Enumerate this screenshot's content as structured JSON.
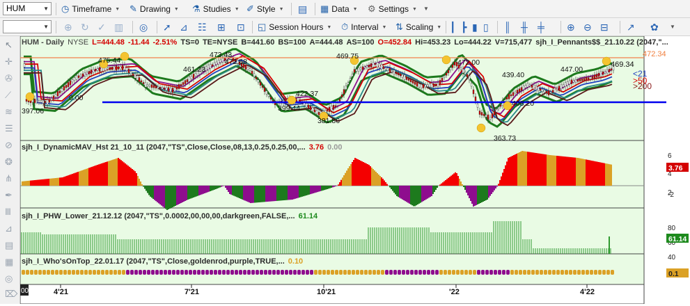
{
  "toolbar1": {
    "symbol": "HUM",
    "timeframe": "Timeframe",
    "drawing": "Drawing",
    "studies": "Studies",
    "style": "Style",
    "data": "Data",
    "settings": "Settings"
  },
  "toolbar2": {
    "session_hours": "Session Hours",
    "interval": "Interval",
    "scaling": "Scaling"
  },
  "price_header": {
    "title": "HUM - Daily",
    "exchange": "NYSE",
    "last": "L=444.48",
    "change": "-11.44",
    "change_pct": "-2.51%",
    "ts": "TS=0",
    "te": "TE=NYSE",
    "bid": "B=441.60",
    "bs": "BS=100",
    "ask": "A=444.48",
    "as": "AS=100",
    "open": "O=452.84",
    "high": "Hi=453.23",
    "low": "Lo=444.22",
    "volume": "V=715,477",
    "study": "sjh_I_Pennants$$_21.10.22 (2047,\"..."
  },
  "price_labels": {
    "top_right": "472.34",
    "last": "469.34",
    "lt21": "<21",
    "gt50": ">50",
    "gt200": ">200"
  },
  "price_annotations": [
    "475.44",
    "397.06",
    "473.43",
    "472.68",
    "461.23",
    "422.37",
    "399.44",
    "381.86",
    "469.75",
    "472.00",
    "439.40",
    "447.00",
    "363.73",
    "408.20",
    "0.00"
  ],
  "indicator_1": {
    "name": "sjh_I_DynamicMAV_Hst 21_10_11 (2047,\"TS\",Close,Close,08,13,0.25,0.25,00,...",
    "value1": "3.76",
    "value2": "0.00"
  },
  "indicator_2": {
    "name": "sjh_I_PHW_Lower_21.12.12 (2047,\"TS\",0.0002,00,00,00,darkgreen,FALSE,...",
    "value": "61.14"
  },
  "indicator_3": {
    "name": "sjh_I_Who'sOnTop_22.01.17 (2047,\"TS\",Close,goldenrod,purple,TRUE,...",
    "value": "0.10"
  },
  "axis": {
    "price_ticks": [],
    "hist_ticks": [
      "6",
      "4",
      "2",
      "-2"
    ],
    "hist_value": "3.76",
    "phw_ticks": [
      "80",
      "60",
      "40"
    ],
    "phw_value": "61.14",
    "wot_value": "0.1",
    "x_ticks": [
      "4'21",
      "7'21",
      "10'21",
      "'22",
      "4'22"
    ],
    "x_start": "00"
  },
  "colors": {
    "panel_bg": "#e9fbe4",
    "up": "#f40000",
    "gold": "#dba126",
    "purple": "#8e0d8e",
    "green": "#1d7a1d",
    "blue_line": "#0000ee",
    "orange_line": "#f3804a"
  }
}
